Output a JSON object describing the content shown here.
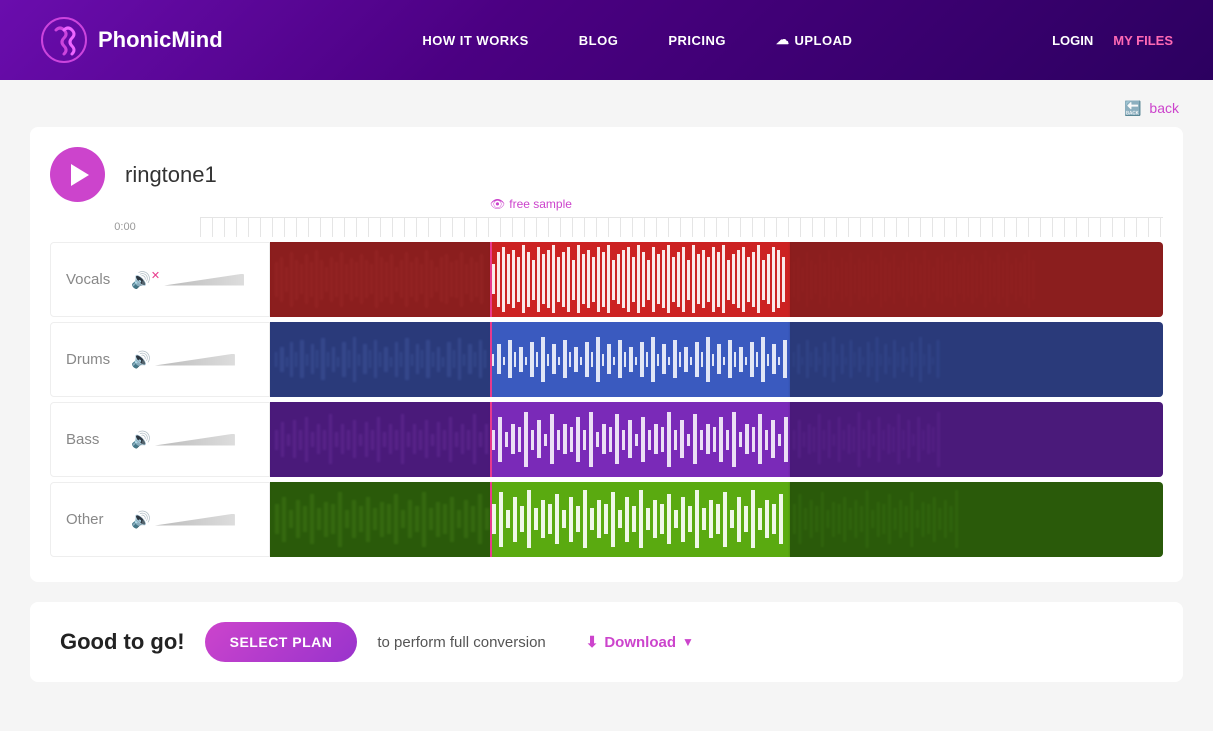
{
  "header": {
    "logo_text": "PhonicMind",
    "nav": {
      "how_it_works": "HOW IT WORKS",
      "blog": "BLOG",
      "pricing": "PRICING",
      "upload": "UPLOAD"
    },
    "auth": {
      "login": "LOGIN",
      "my_files": "MY FILES"
    }
  },
  "player": {
    "back_label": "back",
    "track_name": "ringtone1",
    "time_start": "0:00",
    "free_sample_label": "free sample"
  },
  "tracks": [
    {
      "id": "vocals",
      "label": "Vocals",
      "muted": true,
      "color": "#cc2222"
    },
    {
      "id": "drums",
      "label": "Drums",
      "muted": false,
      "color": "#4a6ad4"
    },
    {
      "id": "bass",
      "label": "Bass",
      "muted": false,
      "color": "#7a2ab8"
    },
    {
      "id": "other",
      "label": "Other",
      "muted": false,
      "color": "#5ab010"
    }
  ],
  "bottom": {
    "good_to_go": "Good to go!",
    "select_plan_label": "SELECT PLAN",
    "perform_text": "to perform full conversion",
    "download_label": "Download"
  }
}
